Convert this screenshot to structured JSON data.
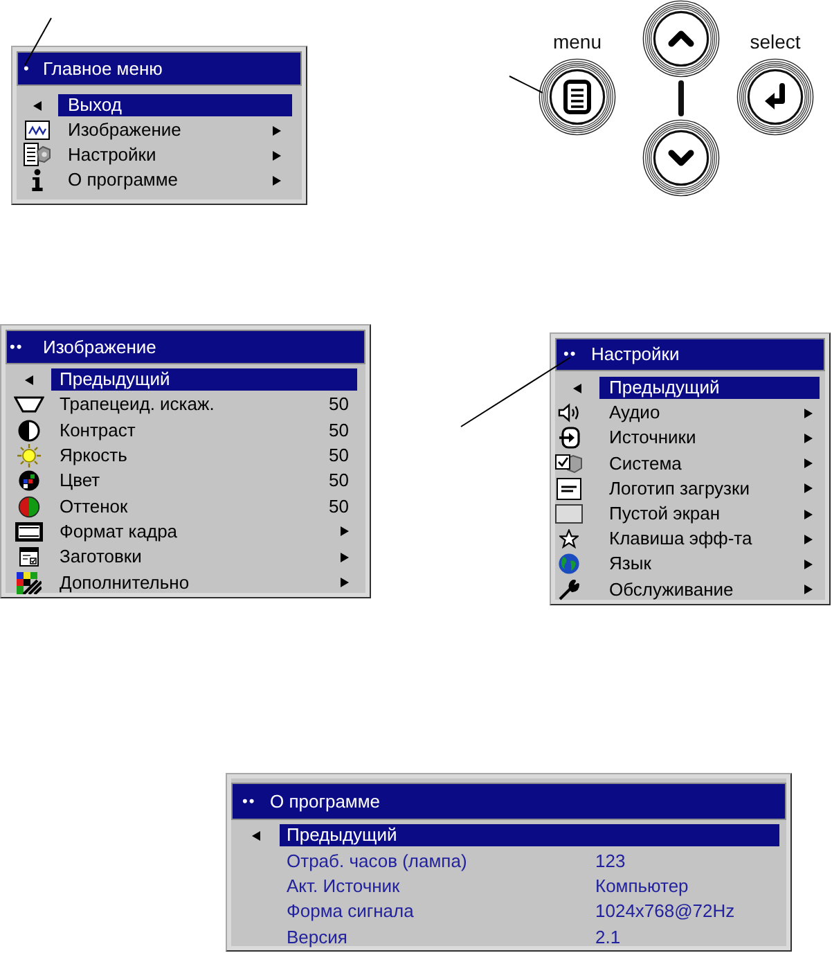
{
  "main_menu": {
    "marker": "•",
    "title": "Главное меню",
    "items": [
      {
        "kind": "back",
        "label": "Выход",
        "selected": true
      },
      {
        "kind": "submenu",
        "label": "Изображение",
        "selected": false
      },
      {
        "kind": "submenu",
        "label": "Настройки",
        "selected": false
      },
      {
        "kind": "submenu",
        "label": "О программе",
        "selected": false
      }
    ]
  },
  "remote": {
    "menu_label": "menu",
    "select_label": "select"
  },
  "image_menu": {
    "marker": "••",
    "title": "Изображение",
    "items": [
      {
        "kind": "back",
        "label": "Предыдущий",
        "selected": true
      },
      {
        "kind": "value",
        "label": "Трапецеид. искаж.",
        "value": "50",
        "selected": false
      },
      {
        "kind": "value",
        "label": "Контраст",
        "value": "50",
        "selected": false
      },
      {
        "kind": "value",
        "label": "Яркость",
        "value": "50",
        "selected": false
      },
      {
        "kind": "value",
        "label": "Цвет",
        "value": "50",
        "selected": false
      },
      {
        "kind": "value",
        "label": "Оттенок",
        "value": "50",
        "selected": false
      },
      {
        "kind": "submenu",
        "label": "Формат кадра",
        "selected": false
      },
      {
        "kind": "submenu",
        "label": "Заготовки",
        "selected": false
      },
      {
        "kind": "submenu",
        "label": "Дополнительно",
        "selected": false
      }
    ]
  },
  "settings_menu": {
    "marker": "••",
    "title": "Настройки",
    "items": [
      {
        "kind": "back",
        "label": "Предыдущий",
        "selected": true
      },
      {
        "kind": "submenu",
        "label": "Аудио",
        "selected": false
      },
      {
        "kind": "submenu",
        "label": "Источники",
        "selected": false
      },
      {
        "kind": "submenu",
        "label": "Система",
        "selected": false
      },
      {
        "kind": "submenu",
        "label": "Логотип загрузки",
        "selected": false
      },
      {
        "kind": "submenu",
        "label": "Пустой экран",
        "selected": false
      },
      {
        "kind": "submenu",
        "label": "Клавиша эфф-та",
        "selected": false
      },
      {
        "kind": "submenu",
        "label": "Язык",
        "selected": false
      },
      {
        "kind": "submenu",
        "label": "Обслуживание",
        "selected": false
      }
    ]
  },
  "about_menu": {
    "marker": "••",
    "title": "О программе",
    "items": [
      {
        "kind": "back",
        "label": "Предыдущий",
        "selected": true
      },
      {
        "kind": "info",
        "label": "Отраб. часов (лампа)",
        "value": "123",
        "selected": false
      },
      {
        "kind": "info",
        "label": "Акт. Источник",
        "value": "Компьютер",
        "selected": false
      },
      {
        "kind": "info",
        "label": "Форма сигнала",
        "value": "1024x768@72Hz",
        "selected": false
      },
      {
        "kind": "info",
        "label": "Версия",
        "value": "2.1",
        "selected": false
      }
    ]
  }
}
